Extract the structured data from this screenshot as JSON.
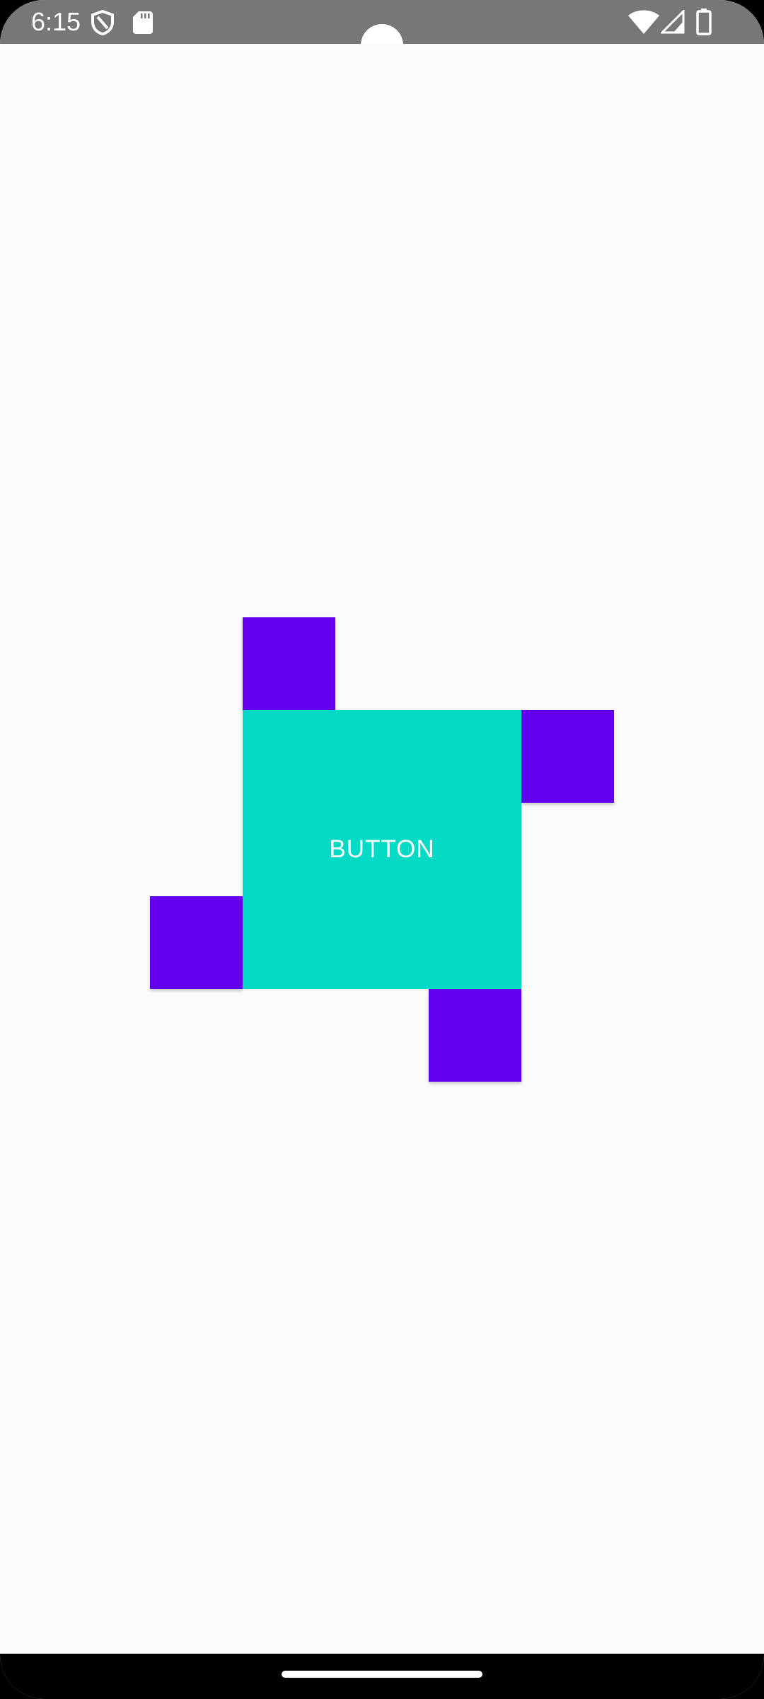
{
  "status_bar": {
    "time": "6:15",
    "left_icons": [
      "shield-icon",
      "sd-card-icon"
    ],
    "right_icons": [
      "wifi-icon",
      "cell-signal-icon",
      "battery-icon"
    ]
  },
  "main": {
    "button_label": "BUTTON",
    "button_color": "#03dac5",
    "square_color": "#6200ee"
  },
  "colors": {
    "background": "#fafafa",
    "status_bar": "#777777",
    "nav_bar": "#000000"
  }
}
